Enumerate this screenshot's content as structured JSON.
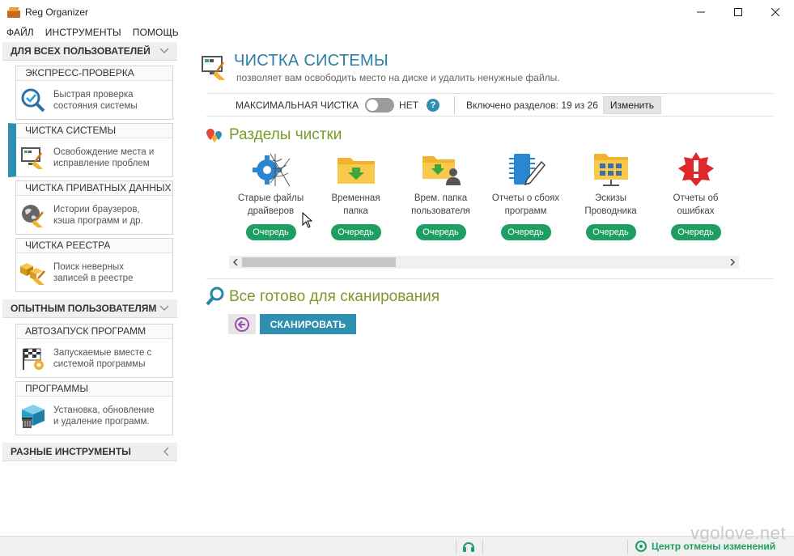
{
  "window": {
    "title": "Reg Organizer"
  },
  "menu": [
    "ФАЙЛ",
    "ИНСТРУМЕНТЫ",
    "ПОМОЩЬ"
  ],
  "sidebar": {
    "groups": [
      {
        "label": "ДЛЯ ВСЕХ ПОЛЬЗОВАТЕЛЕЙ",
        "chevron": "chevron-down-icon"
      },
      {
        "label": "ОПЫТНЫМ ПОЛЬЗОВАТЕЛЯМ",
        "chevron": "chevron-down-icon"
      },
      {
        "label": "РАЗНЫЕ ИНСТРУМЕНТЫ",
        "chevron": "chevron-left-icon"
      }
    ],
    "items": [
      {
        "title": "ЭКСПРЕСС-ПРОВЕРКА",
        "desc1": "Быстрая проверка",
        "desc2": "состояния системы",
        "icon": "magnifier-check-icon",
        "active": false
      },
      {
        "title": "ЧИСТКА СИСТЕМЫ",
        "desc1": "Освобождение места и",
        "desc2": "исправление проблем",
        "icon": "monitor-broom-icon",
        "active": true
      },
      {
        "title": "ЧИСТКА ПРИВАТНЫХ ДАННЫХ",
        "desc1": "Истории браузеров,",
        "desc2": "кэша программ и др.",
        "icon": "globe-broom-icon",
        "active": false
      },
      {
        "title": "ЧИСТКА РЕЕСТРА",
        "desc1": "Поиск неверных",
        "desc2": "записей в реестре",
        "icon": "registry-cubes-icon",
        "active": false
      },
      {
        "title": "АВТОЗАПУСК ПРОГРАММ",
        "desc1": "Запускаемые вместе с",
        "desc2": "системой программы",
        "icon": "checkered-flag-icon",
        "active": false
      },
      {
        "title": "ПРОГРАММЫ",
        "desc1": "Установка, обновление",
        "desc2": "и удаление программ.",
        "icon": "box-trash-icon",
        "active": false
      }
    ]
  },
  "main": {
    "title": "ЧИСТКА СИСТЕМЫ",
    "subtitle": "позволяет вам освободить место на диске и удалить ненужные файлы.",
    "max_clean_label": "МАКСИМАЛЬНАЯ ЧИСТКА",
    "max_clean_state": "НЕТ",
    "help": "?",
    "sections_count": "Включено разделов: 19 из 26",
    "change_label": "Изменить",
    "sections_title": "Разделы чистки",
    "cards": [
      {
        "line1": "Старые файлы",
        "line2": "драйверов",
        "icon": "gear-cobweb-icon",
        "button": "Очередь"
      },
      {
        "line1": "Временная",
        "line2": "папка",
        "icon": "folder-download-icon",
        "button": "Очередь"
      },
      {
        "line1": "Врем. папка",
        "line2": "пользователя",
        "icon": "folder-user-icon",
        "button": "Очередь"
      },
      {
        "line1": "Отчеты о сбоях",
        "line2": "программ",
        "icon": "chip-pencil-icon",
        "button": "Очередь"
      },
      {
        "line1": "Эскизы",
        "line2": "Проводника",
        "icon": "folder-thumbnails-icon",
        "button": "Очередь"
      },
      {
        "line1": "Отчеты об",
        "line2": "ошибках",
        "icon": "error-badge-icon",
        "button": "Очередь"
      }
    ],
    "ready_title": "Все готово для сканирования",
    "scan_label": "СКАНИРОВАТЬ"
  },
  "statusbar": {
    "undo_center": "Центр отмены изменений"
  },
  "watermark": "vgolove.net",
  "colors": {
    "accent": "#2e8fb0",
    "green": "#1f9e63",
    "olive": "#7a9a2a"
  }
}
